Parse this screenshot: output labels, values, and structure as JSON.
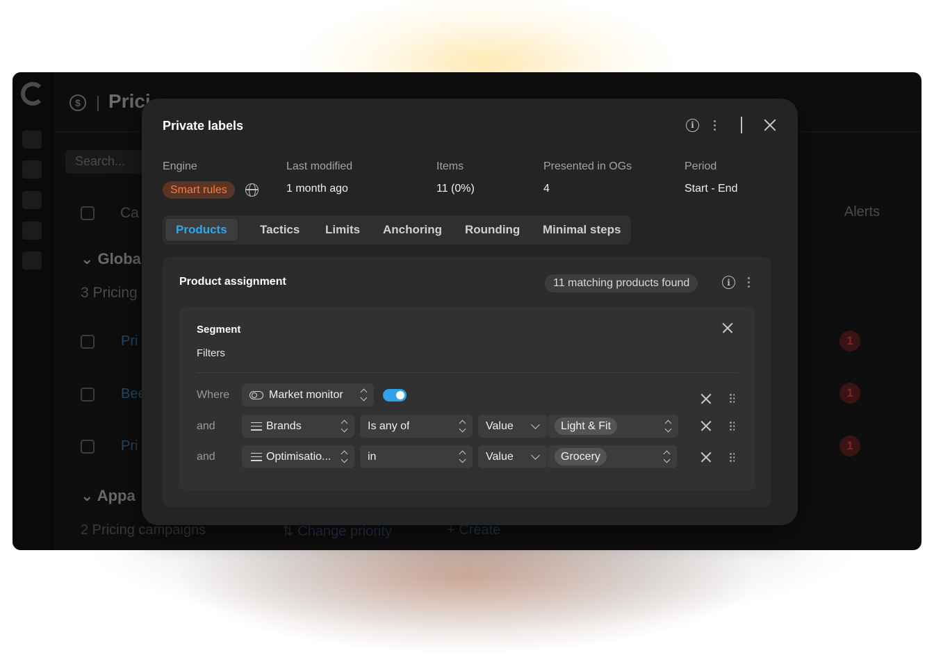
{
  "background_app": {
    "header_title": "Prici",
    "search_placeholder": "Search...",
    "column_alerts": "Alerts",
    "column_partial": "Ca",
    "group1_label": "Globa",
    "group1_count": "3 Pricing",
    "rows": [
      {
        "name": "Pri",
        "alerts": "1"
      },
      {
        "name": "Bee",
        "alerts": "1"
      },
      {
        "name": "Pri",
        "alerts": "1"
      }
    ],
    "group2_label": "Appa",
    "group2_count": "2 Pricing campaigns",
    "change_priority": "Change priority",
    "create": "Create"
  },
  "modal": {
    "title": "Private labels",
    "meta": {
      "engine_label": "Engine",
      "engine_value": "Smart rules",
      "last_modified_label": "Last modified",
      "last_modified_value": "1 month ago",
      "items_label": "Items",
      "items_value": "11 (0%)",
      "presented_label": "Presented in OGs",
      "presented_value": "4",
      "period_label": "Period",
      "period_value": "Start - End"
    },
    "tabs": [
      "Products",
      "Tactics",
      "Limits",
      "Anchoring",
      "Rounding",
      "Minimal steps"
    ],
    "active_tab": "Products",
    "card": {
      "title": "Product assignment",
      "match_text": "11 matching products found",
      "segment": {
        "title": "Segment",
        "filters_label": "Filters",
        "rows": [
          {
            "connector": "Where",
            "field": "Market monitor",
            "toggle_on": true
          },
          {
            "connector": "and",
            "field": "Brands",
            "operator": "Is any of",
            "value_type": "Value",
            "value": "Light & Fit"
          },
          {
            "connector": "and",
            "field": "Optimisatio...",
            "operator": "in",
            "value_type": "Value",
            "value": "Grocery"
          }
        ]
      }
    }
  },
  "colors": {
    "accent_blue": "#2fa7ec",
    "engine_orange": "#ff7a3c",
    "modal_bg": "#242424",
    "alert_red": "#7a2a22"
  }
}
